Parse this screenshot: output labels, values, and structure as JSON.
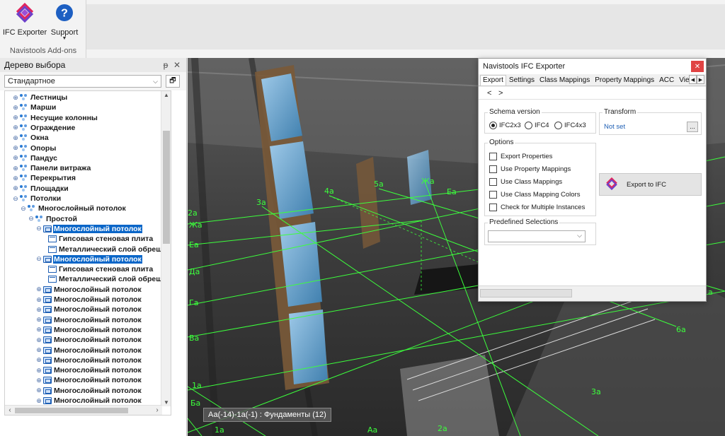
{
  "ribbon": {
    "ifc_exporter_label": "IFC Exporter",
    "support_label": "Support",
    "group_label": "Navistools Add-ons"
  },
  "tree": {
    "title": "Дерево выбора",
    "pin_symbol": "ᵽ",
    "close_symbol": "✕",
    "dropdown_value": "Стандартное",
    "nodes": [
      {
        "label": "Лестницы"
      },
      {
        "label": "Марши"
      },
      {
        "label": "Несущие колонны"
      },
      {
        "label": "Ограждение"
      },
      {
        "label": "Окна"
      },
      {
        "label": "Опоры"
      },
      {
        "label": "Пандус"
      },
      {
        "label": "Панели витража"
      },
      {
        "label": "Перекрытия"
      },
      {
        "label": "Площадки"
      },
      {
        "label": "Потолки"
      },
      {
        "label": "Многослойный потолок"
      },
      {
        "label": "Простой"
      },
      {
        "label": "Многослойный потолок"
      },
      {
        "label": "Гипсовая стеновая плита"
      },
      {
        "label": "Металлический слой обрешетки"
      },
      {
        "label": "Многослойный потолок"
      },
      {
        "label": "Гипсовая стеновая плита"
      },
      {
        "label": "Металлический слой обрешетки"
      },
      {
        "label": "Многослойный потолок"
      },
      {
        "label": "Многослойный потолок"
      },
      {
        "label": "Многослойный потолок"
      },
      {
        "label": "Многослойный потолок"
      },
      {
        "label": "Многослойный потолок"
      },
      {
        "label": "Многослойный потолок"
      },
      {
        "label": "Многослойный потолок"
      },
      {
        "label": "Многослойный потолок"
      },
      {
        "label": "Многослойный потолок"
      },
      {
        "label": "Многослойный потолок"
      },
      {
        "label": "Многослойный потолок"
      },
      {
        "label": "Многослойный потолок"
      },
      {
        "label": "Многослойный потолок"
      }
    ]
  },
  "viewport": {
    "grid_labels": [
      "2а",
      "Жа",
      "Еа",
      "Да",
      "Га",
      "Ва",
      "1а",
      "Ба",
      "3а",
      "4а",
      "5а",
      "Жа",
      "Еа",
      "6а",
      "3а",
      "Аа",
      "2а",
      "1а",
      "1а"
    ],
    "tooltip": "Аа(-14)-1а(-1) : Фундаменты (12)",
    "grid_color": "#3cff3c"
  },
  "dialog": {
    "title": "Navistools IFC Exporter",
    "close_symbol": "✕",
    "tabs": [
      "Export",
      "Settings",
      "Class Mappings",
      "Property Mappings",
      "ACC",
      "Viewer"
    ],
    "active_tab": "Export",
    "nav_back": "<",
    "nav_forward": ">",
    "schema": {
      "legend": "Schema version",
      "options": [
        "IFC2x3",
        "IFC4",
        "IFC4x3"
      ],
      "selected": "IFC2x3"
    },
    "transform": {
      "legend": "Transform",
      "value": "Not set",
      "button": "..."
    },
    "options": {
      "legend": "Options",
      "items": [
        {
          "label": "Export Properties",
          "checked": false
        },
        {
          "label": "Use Property Mappings",
          "checked": false
        },
        {
          "label": "Use Class Mappings",
          "checked": false
        },
        {
          "label": "Use Class Mapping Colors",
          "checked": false
        },
        {
          "label": "Check for Multiple Instances",
          "checked": false
        }
      ]
    },
    "export_button": "Export to IFC",
    "predefined": {
      "legend": "Predefined Selections",
      "value": ""
    }
  },
  "colors": {
    "selection": "#0a66c8",
    "close_red": "#e04343",
    "link_blue": "#1e5fb4"
  }
}
